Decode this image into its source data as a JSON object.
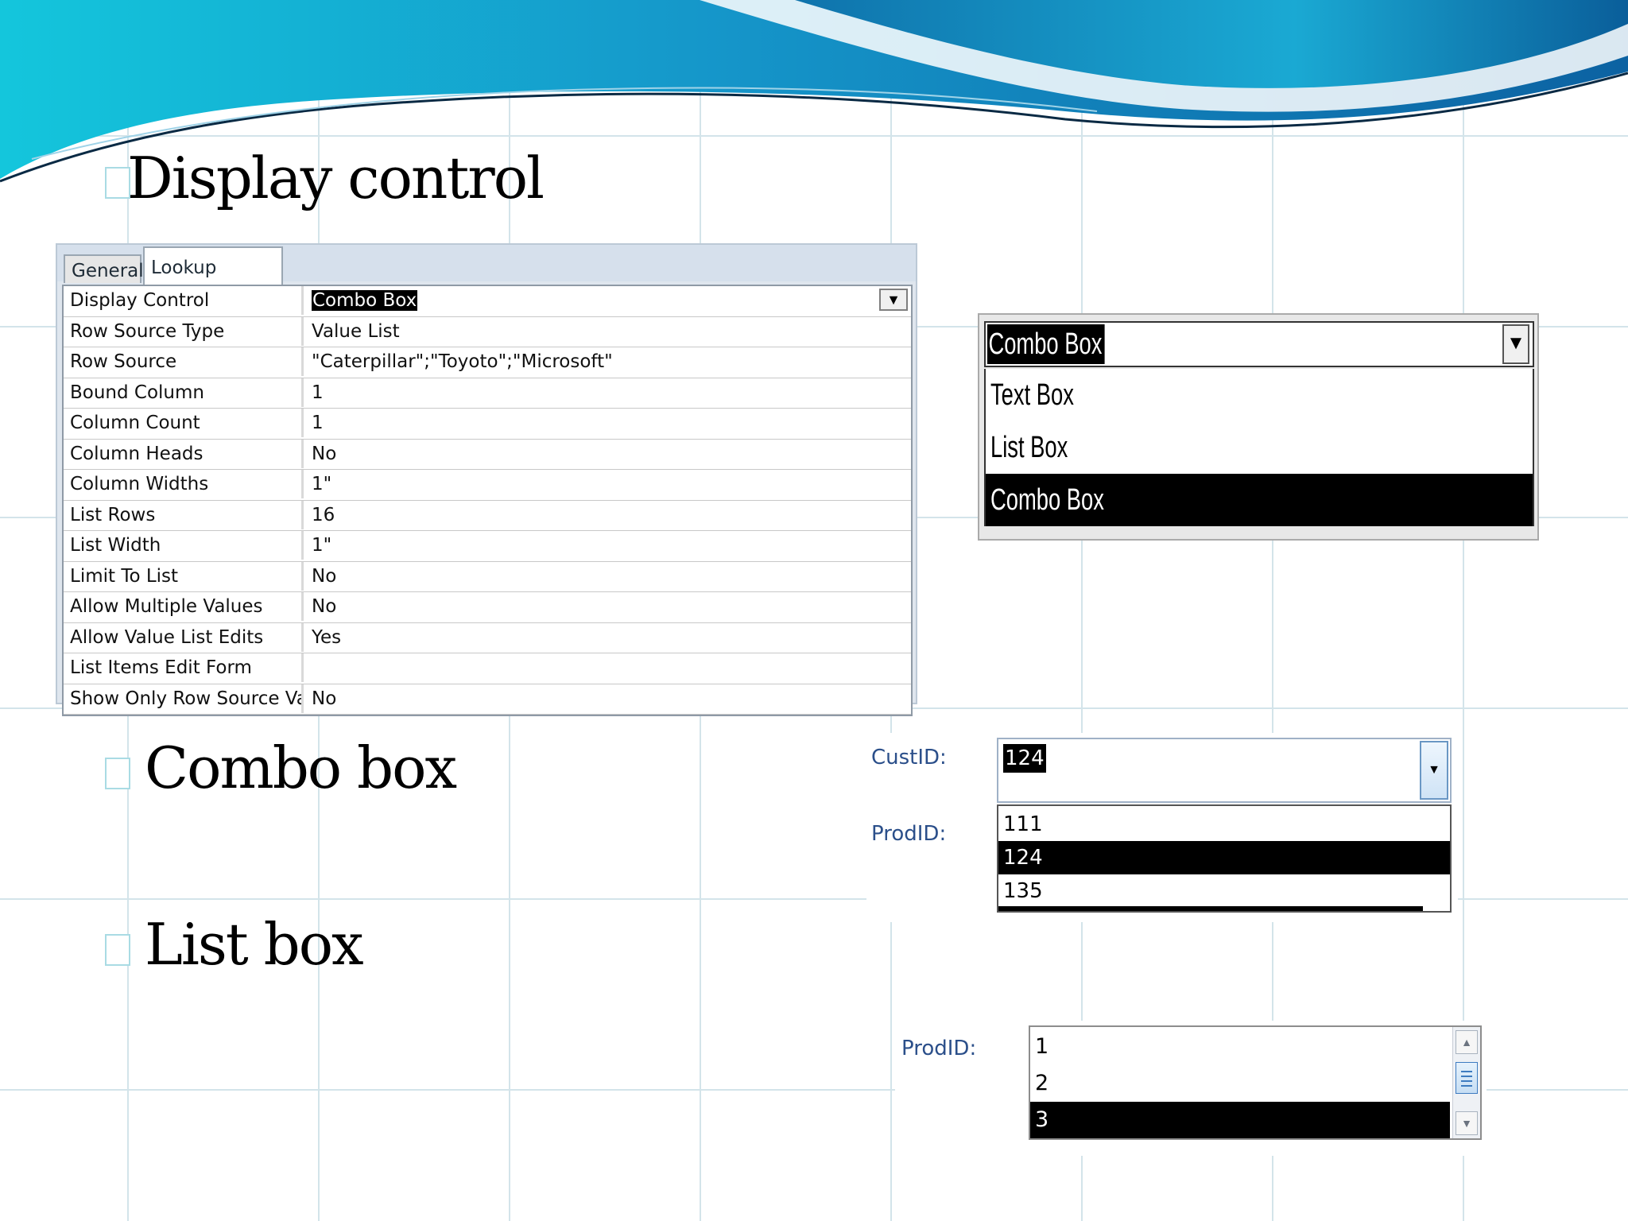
{
  "slide": {
    "bullet1": "Display control",
    "bullet2": "Combo box",
    "bullet3": "List box"
  },
  "property_sheet": {
    "tabs": [
      "General",
      "Lookup"
    ],
    "active_tab": "Lookup",
    "rows": [
      {
        "name": "Display Control",
        "value": "Combo Box"
      },
      {
        "name": "Row Source Type",
        "value": "Value List"
      },
      {
        "name": "Row Source",
        "value": "\"Caterpillar\";\"Toyoto\";\"Microsoft\""
      },
      {
        "name": "Bound Column",
        "value": "1"
      },
      {
        "name": "Column Count",
        "value": "1"
      },
      {
        "name": "Column Heads",
        "value": "No"
      },
      {
        "name": "Column Widths",
        "value": "1\""
      },
      {
        "name": "List Rows",
        "value": "16"
      },
      {
        "name": "List Width",
        "value": "1\""
      },
      {
        "name": "Limit To List",
        "value": "No"
      },
      {
        "name": "Allow Multiple Values",
        "value": "No"
      },
      {
        "name": "Allow Value List Edits",
        "value": "Yes"
      },
      {
        "name": "List Items Edit Form",
        "value": ""
      },
      {
        "name": "Show Only Row Source Valu",
        "value": "No"
      }
    ]
  },
  "display_control_dropdown": {
    "selected": "Combo Box",
    "options": [
      "Text Box",
      "List Box",
      "Combo Box"
    ]
  },
  "combo_example": {
    "custid_label": "CustID:",
    "prodid_label": "ProdID:",
    "selected": "124",
    "options": [
      "111",
      "124",
      "135"
    ]
  },
  "listbox_example": {
    "prodid_label": "ProdID:",
    "options": [
      "1",
      "2",
      "3"
    ],
    "selected": "3"
  },
  "colors": {
    "wave_dark": "#0b6fa8",
    "wave_light": "#25b9d4",
    "label_blue": "#2b4f8a",
    "highlight": "#000000"
  }
}
